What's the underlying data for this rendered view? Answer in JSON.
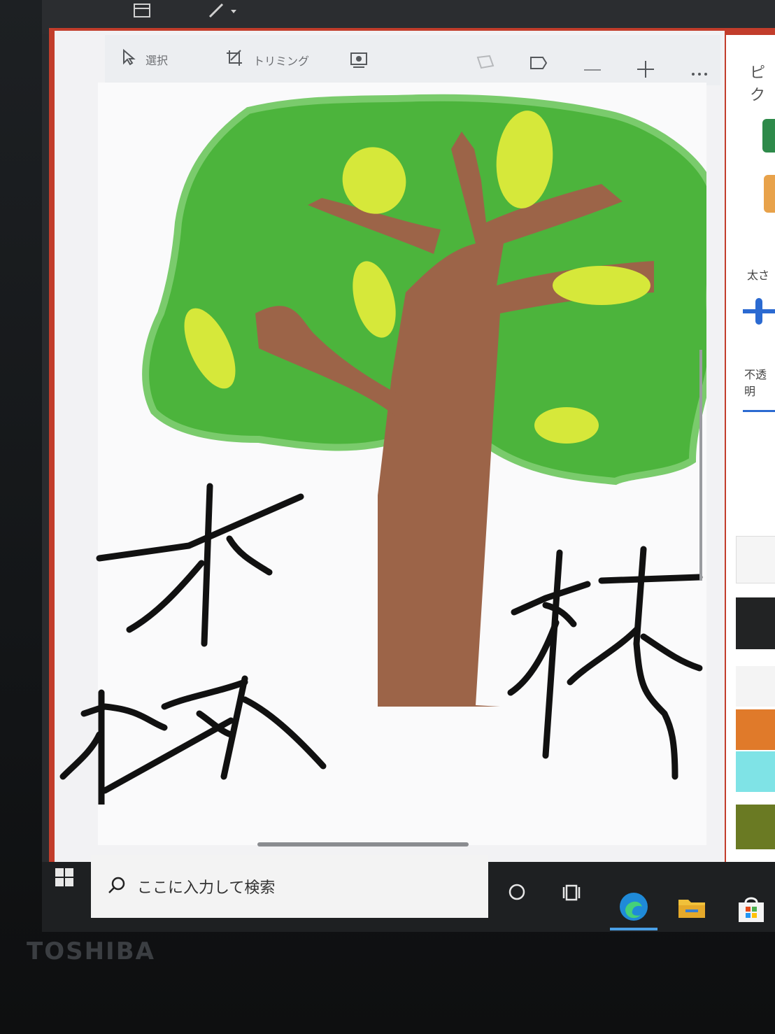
{
  "toolbar": {
    "select_label": "選択",
    "crop_label": "トリミング"
  },
  "side_panel": {
    "title": "ピク",
    "size_label": "太さ",
    "opacity_label": "不透明"
  },
  "palette": {
    "colors": [
      "#f5f5f5",
      "#222324",
      "#f4f4f4",
      "#e07a2a",
      "#7fe3e6",
      "#6a7a23"
    ]
  },
  "canvas": {
    "handwriting": [
      "木",
      "林",
      "林"
    ]
  },
  "taskbar": {
    "search_placeholder": "ここに入力して検索"
  },
  "device": {
    "brand": "TOSHIBA"
  },
  "colors": {
    "leaf_green": "#4cb43c",
    "leaf_yellow": "#d6e83a",
    "trunk_brown": "#9c6448",
    "window_accent": "#c23d2b"
  }
}
